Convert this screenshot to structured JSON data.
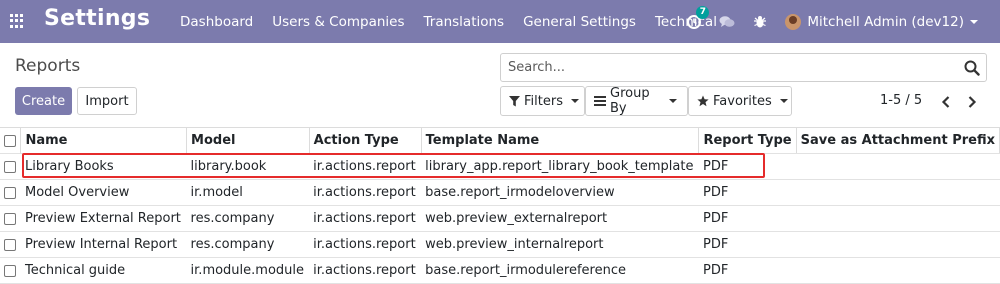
{
  "nav": {
    "brand": "Settings",
    "menu": [
      "Dashboard",
      "Users & Companies",
      "Translations",
      "General Settings",
      "Technical"
    ],
    "activity_badge": "7",
    "user_name": "Mitchell Admin (dev12)"
  },
  "control": {
    "title": "Reports",
    "create_label": "Create",
    "import_label": "Import",
    "search_placeholder": "Search...",
    "filters_label": "Filters",
    "groupby_label": "Group By",
    "favorites_label": "Favorites",
    "pager": "1-5 / 5"
  },
  "table": {
    "headers": [
      "Name",
      "Model",
      "Action Type",
      "Template Name",
      "Report Type",
      "Save as Attachment Prefix"
    ],
    "rows": [
      [
        "Library Books",
        "library.book",
        "ir.actions.report",
        "library_app.report_library_book_template",
        "PDF",
        ""
      ],
      [
        "Model Overview",
        "ir.model",
        "ir.actions.report",
        "base.report_irmodeloverview",
        "PDF",
        ""
      ],
      [
        "Preview External Report",
        "res.company",
        "ir.actions.report",
        "web.preview_externalreport",
        "PDF",
        ""
      ],
      [
        "Preview Internal Report",
        "res.company",
        "ir.actions.report",
        "web.preview_internalreport",
        "PDF",
        ""
      ],
      [
        "Technical guide",
        "ir.module.module",
        "ir.actions.report",
        "base.report_irmodulereference",
        "PDF",
        ""
      ]
    ]
  },
  "colors": {
    "navbar": "#7c7bad",
    "primary_button": "#7c7bad",
    "badge": "#00a09d",
    "highlight": "#e52b2b"
  }
}
